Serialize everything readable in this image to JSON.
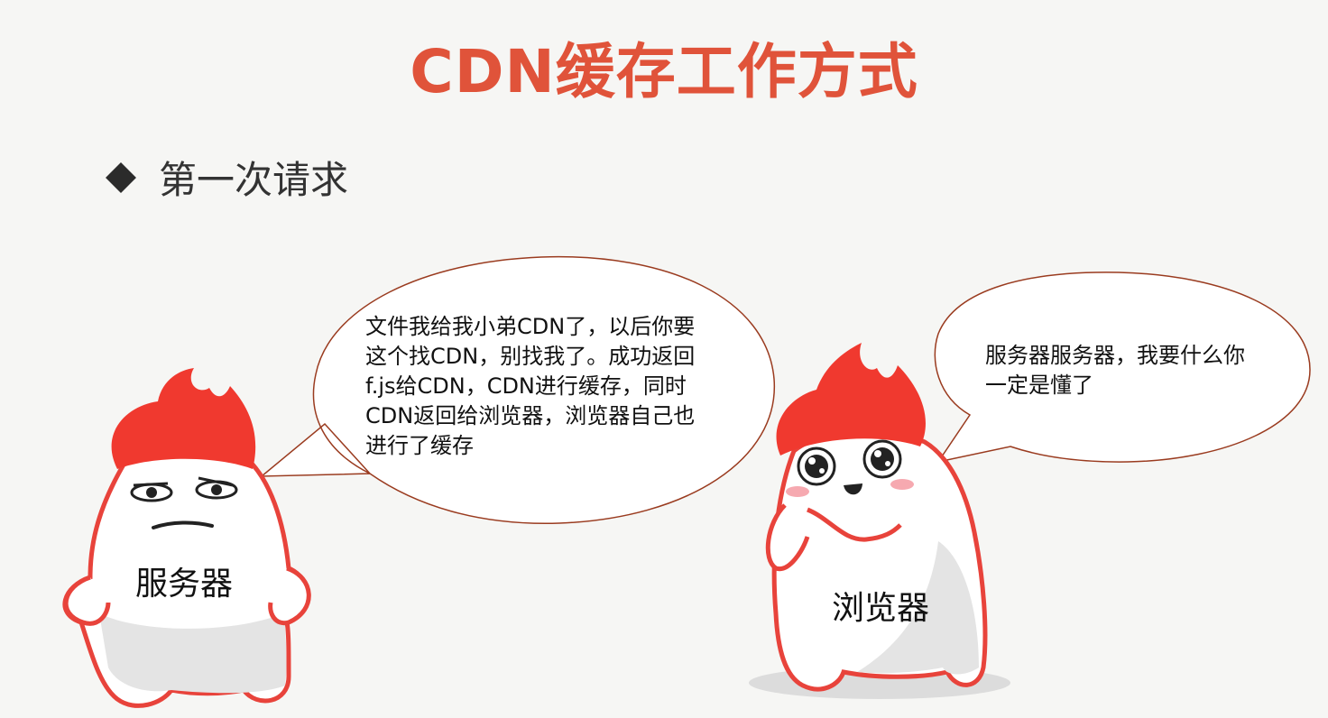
{
  "title": "CDN缓存工作方式",
  "bullet": {
    "text": "第一次请求"
  },
  "server_bubble": {
    "lines": [
      "文件我给我小弟CDN了，以后你要",
      "这个找CDN，别找我了。成功返回",
      "f.js给CDN，CDN进行缓存，同时",
      "CDN返回给浏览器，浏览器自己也",
      "进行了缓存"
    ]
  },
  "browser_bubble": {
    "lines": [
      "服务器服务器，我要什么你",
      "一定是懂了"
    ]
  },
  "characters": {
    "server_label": "服务器",
    "browser_label": "浏览器"
  },
  "colors": {
    "title": "#e0533a",
    "flame": "#f0392f",
    "outline": "#e8433b",
    "bubble_border": "#9a3b1f",
    "body_fill": "#ffffff",
    "body_shade": "#e4e4e4"
  }
}
